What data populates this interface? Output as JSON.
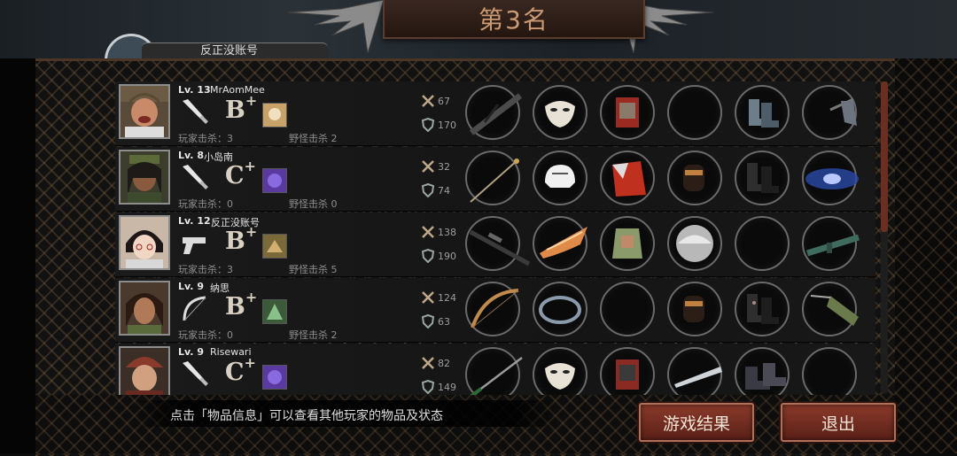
{
  "header": {
    "rank_title": "第3名",
    "previous_player_name": "反正没账号"
  },
  "labels": {
    "player_kills": "玩家击杀：",
    "monster_kills": "野怪击杀",
    "level_prefix": "Lv."
  },
  "players": [
    {
      "level": "13",
      "name": "MrAomMee",
      "grade": "B",
      "grade_mod": "+",
      "player_kills": "3",
      "monster_kills": "2",
      "attack": "67",
      "defense": "170",
      "weapon_icon": "knife-icon",
      "gear": [
        "umbrella-icon",
        "mask-icon",
        "red-armor-icon",
        "empty-slot",
        "boots-icon",
        "cloak-icon"
      ]
    },
    {
      "level": "8",
      "name": "小岛南",
      "grade": "C",
      "grade_mod": "+",
      "player_kills": "0",
      "monster_kills": "0",
      "attack": "32",
      "defense": "74",
      "weapon_icon": "knife-icon",
      "gear": [
        "rapier-icon",
        "helmet-icon",
        "red-cape-icon",
        "bracer-icon",
        "boots-icon",
        "galaxy-orb-icon"
      ]
    },
    {
      "level": "12",
      "name": "反正没账号",
      "grade": "B",
      "grade_mod": "+",
      "player_kills": "3",
      "monster_kills": "5",
      "attack": "138",
      "defense": "190",
      "weapon_icon": "pistol-icon",
      "gear": [
        "sniper-rifle-icon",
        "tiara-icon",
        "vest-icon",
        "disc-icon",
        "empty-slot",
        "rifle-icon"
      ]
    },
    {
      "level": "9",
      "name": "纳思",
      "grade": "B",
      "grade_mod": "+",
      "player_kills": "0",
      "monster_kills": "2",
      "attack": "124",
      "defense": "63",
      "weapon_icon": "bow-icon",
      "gear": [
        "bow-icon",
        "headband-icon",
        "empty-slot",
        "bracer-icon",
        "boots-icon",
        "quiver-icon"
      ]
    },
    {
      "level": "9",
      "name": "Risewari",
      "grade": "C",
      "grade_mod": "+",
      "player_kills": "",
      "monster_kills": "",
      "attack": "82",
      "defense": "149",
      "weapon_icon": "knife-icon",
      "gear": [
        "katana-icon",
        "mask-icon",
        "red-armor-icon",
        "sheath-icon",
        "boots-icon",
        "empty-slot"
      ]
    }
  ],
  "footer": {
    "hint": "点击「物品信息」可以查看其他玩家的物品及状态",
    "result_button": "游戏结果",
    "exit_button": "退出"
  }
}
